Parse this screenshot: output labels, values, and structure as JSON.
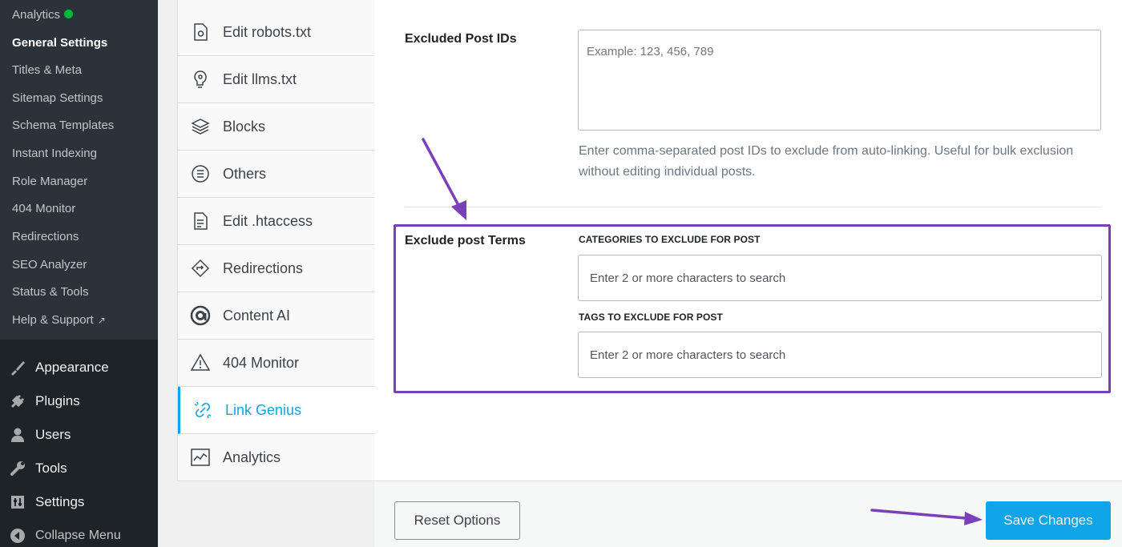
{
  "admin_menu": {
    "submenu": [
      {
        "label": "Analytics",
        "status": "active"
      },
      {
        "label": "General Settings",
        "current": true
      },
      {
        "label": "Titles & Meta"
      },
      {
        "label": "Sitemap Settings"
      },
      {
        "label": "Schema Templates"
      },
      {
        "label": "Instant Indexing"
      },
      {
        "label": "Role Manager"
      },
      {
        "label": "404 Monitor"
      },
      {
        "label": "Redirections"
      },
      {
        "label": "SEO Analyzer"
      },
      {
        "label": "Status & Tools"
      },
      {
        "label": "Help & Support",
        "icon": "external-link-icon"
      }
    ],
    "main": [
      {
        "label": "Appearance",
        "icon": "paintbrush-icon"
      },
      {
        "label": "Plugins",
        "icon": "plug-icon"
      },
      {
        "label": "Users",
        "icon": "user-icon"
      },
      {
        "label": "Tools",
        "icon": "wrench-icon"
      },
      {
        "label": "Settings",
        "icon": "sliders-icon"
      },
      {
        "label": "Collapse Menu",
        "icon": "collapse-arrow-icon"
      }
    ]
  },
  "tabs": [
    {
      "label": "Edit robots.txt",
      "icon": "robots-file-icon"
    },
    {
      "label": "Edit llms.txt",
      "icon": "llms-file-icon"
    },
    {
      "label": "Blocks",
      "icon": "blocks-icon"
    },
    {
      "label": "Others",
      "icon": "others-list-icon"
    },
    {
      "label": "Edit .htaccess",
      "icon": "htaccess-file-icon"
    },
    {
      "label": "Redirections",
      "icon": "redirect-diamond-icon"
    },
    {
      "label": "Content AI",
      "icon": "content-ai-icon"
    },
    {
      "label": "404 Monitor",
      "icon": "warning-triangle-icon"
    },
    {
      "label": "Link Genius",
      "icon": "link-icon",
      "active": true
    },
    {
      "label": "Analytics",
      "icon": "analytics-chart-icon"
    }
  ],
  "form": {
    "excluded_ids": {
      "label": "Excluded Post IDs",
      "placeholder": "Example: 123, 456, 789",
      "value": "",
      "description": "Enter comma-separated post IDs to exclude from auto-linking. Useful for bulk exclusion without editing individual posts."
    },
    "exclude_terms": {
      "label": "Exclude post Terms",
      "categories_label": "CATEGORIES TO EXCLUDE FOR POST",
      "categories_placeholder": "Enter 2 or more characters to search",
      "tags_label": "TAGS TO EXCLUDE FOR POST",
      "tags_placeholder": "Enter 2 or more characters to search"
    }
  },
  "footer": {
    "reset_label": "Reset Options",
    "save_label": "Save Changes"
  },
  "colors": {
    "accent": "#10a5e7",
    "annotation": "#7b3fb9",
    "sidebar_bg": "#1d2327",
    "status_dot": "#00ba37"
  }
}
